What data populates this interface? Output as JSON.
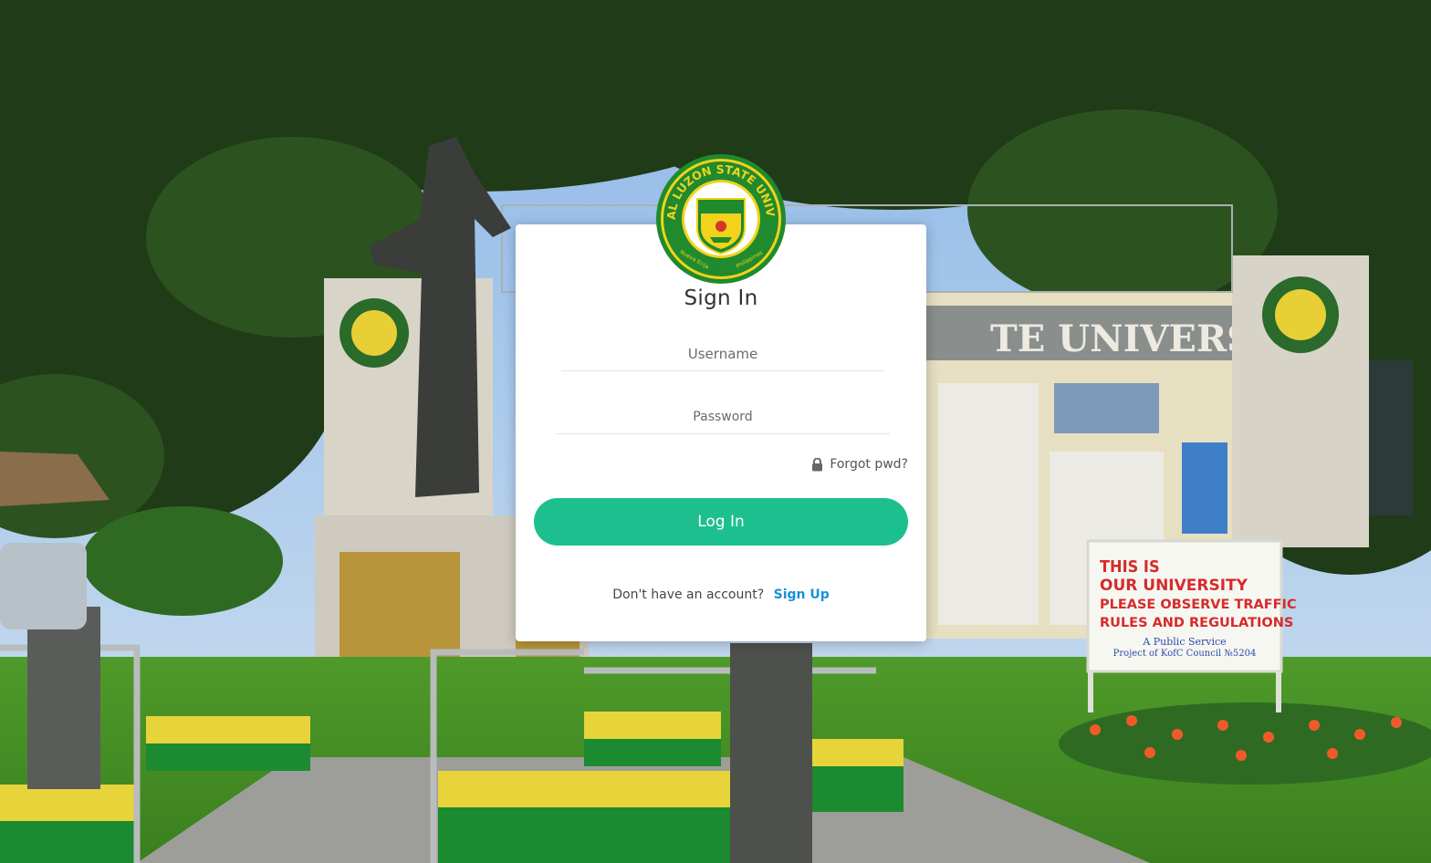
{
  "background": {
    "gate_text": "TE UNIVERSITY",
    "sign": {
      "lines": [
        "THIS IS",
        "OUR UNIVERSITY",
        "PLEASE OBSERVE TRAFFIC",
        "RULES AND REGULATIONS"
      ],
      "footer_lines": [
        "A Public Service",
        "Project of KofC Council №5204"
      ]
    }
  },
  "logo": {
    "ring_text": "CENTRAL LUZON STATE UNIVERSITY",
    "year": "1907",
    "left_text": "Nueva Ecija",
    "right_text": "Philippines"
  },
  "login": {
    "title": "Sign In",
    "username_placeholder": "Username",
    "password_placeholder": "Password",
    "forgot_label": "Forgot pwd?",
    "login_button": "Log In",
    "no_account_text": "Don't have an account?",
    "signup_label": "Sign Up"
  },
  "colors": {
    "button": "#1dbf8e",
    "link": "#1a8fd8",
    "seal_green": "#1f8a2e",
    "seal_yellow": "#f2d21a"
  }
}
